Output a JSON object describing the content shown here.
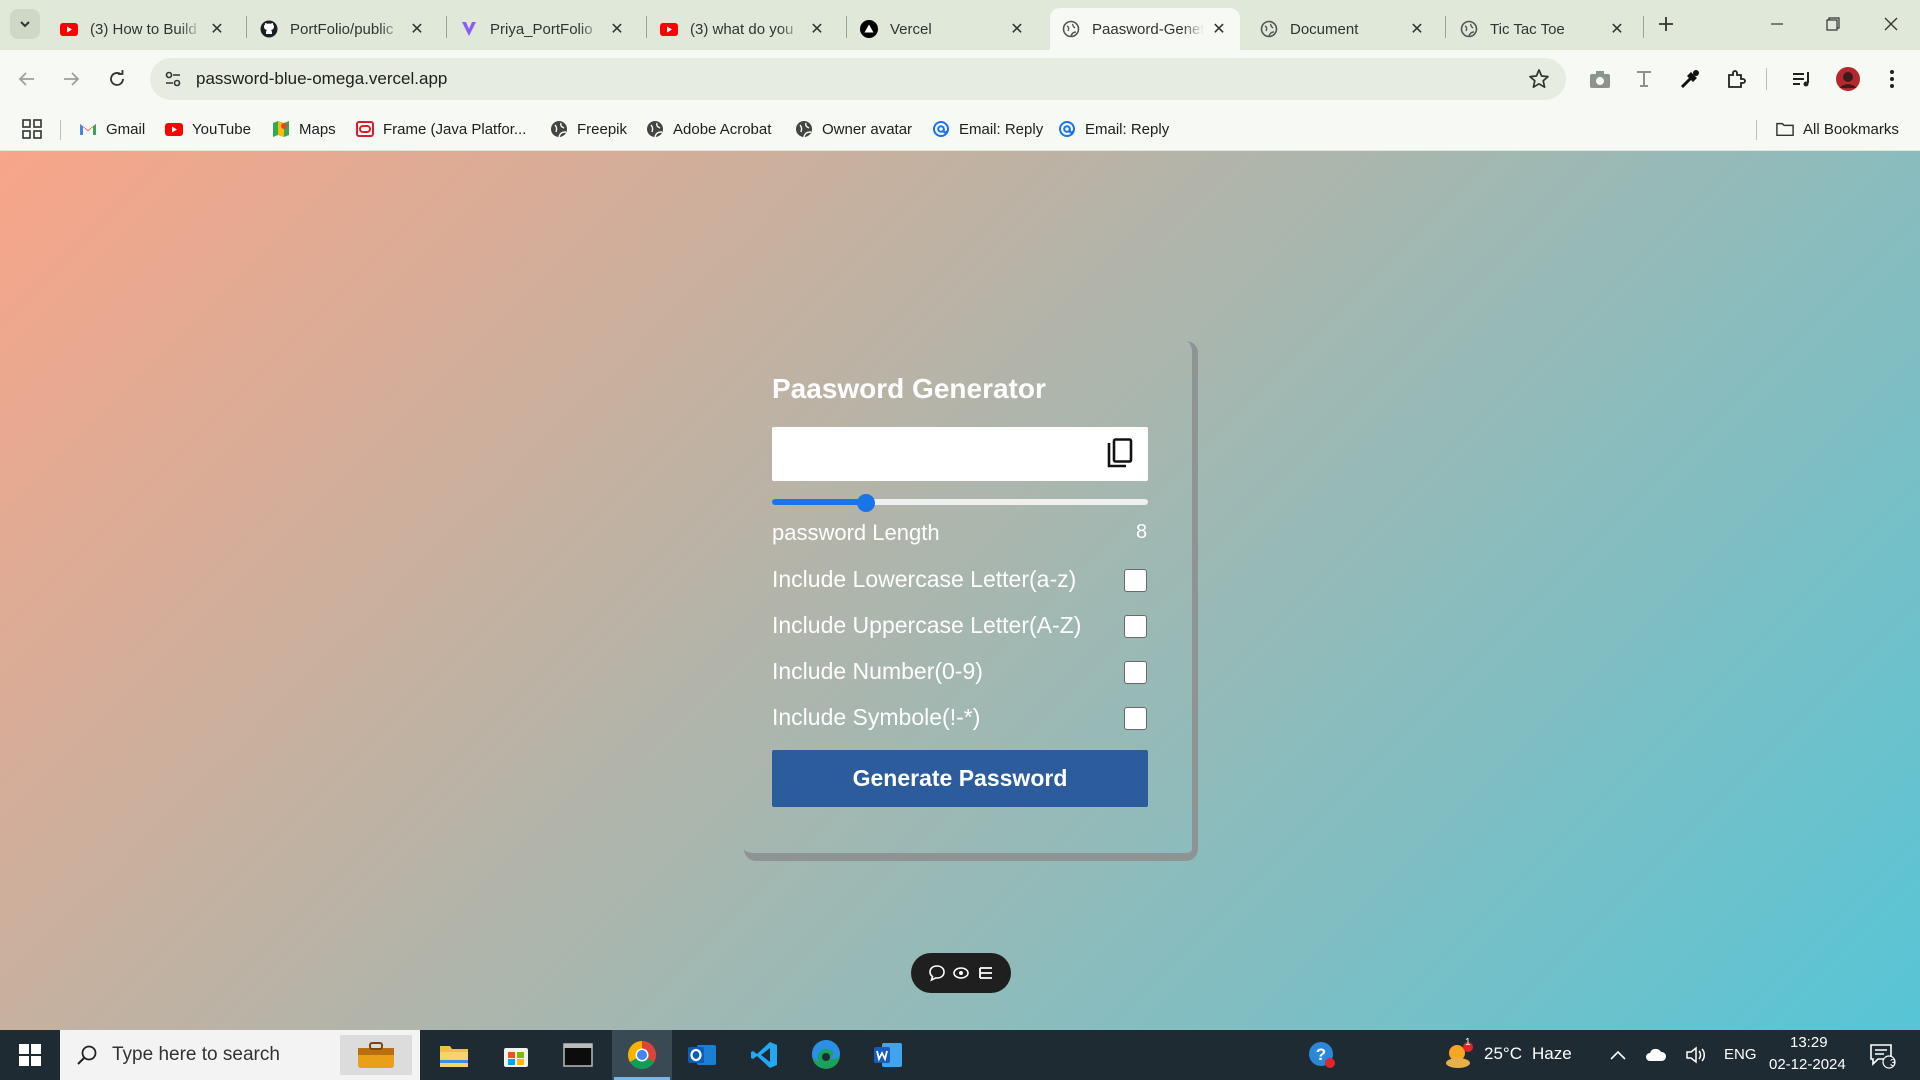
{
  "browser": {
    "tabs": [
      {
        "title": "(3) How to Build",
        "icon": "youtube-icon"
      },
      {
        "title": "PortFolio/public",
        "icon": "github-icon"
      },
      {
        "title": "Priya_PortFolio",
        "icon": "vercel-v-icon"
      },
      {
        "title": "(3) what do you",
        "icon": "youtube-icon"
      },
      {
        "title": "Vercel",
        "icon": "vercel-triangle-icon"
      },
      {
        "title": "Paasword-Genet",
        "icon": "globe-icon",
        "active": true
      },
      {
        "title": "Document",
        "icon": "globe-icon"
      },
      {
        "title": "Tic Tac Toe",
        "icon": "globe-icon"
      }
    ],
    "url": "password-blue-omega.vercel.app",
    "bookmarks": [
      {
        "label": "Gmail",
        "icon": "gmail-icon"
      },
      {
        "label": "YouTube",
        "icon": "youtube-icon"
      },
      {
        "label": "Maps",
        "icon": "maps-icon"
      },
      {
        "label": "Frame (Java Platfor...",
        "icon": "oracle-icon"
      },
      {
        "label": "Freepik",
        "icon": "globe-icon"
      },
      {
        "label": "Adobe Acrobat",
        "icon": "globe-icon"
      },
      {
        "label": "Owner avatar",
        "icon": "globe-icon"
      },
      {
        "label": "Email: Reply",
        "icon": "email-icon"
      },
      {
        "label": "Email: Reply",
        "icon": "email-icon"
      }
    ],
    "all_bookmarks": "All Bookmarks"
  },
  "app": {
    "title": "Paasword Generator",
    "password_value": "",
    "length_label": "password Length",
    "length_value": "8",
    "slider_fraction": 0.25,
    "options": [
      {
        "label": "Include Lowercase Letter(a-z)",
        "checked": false
      },
      {
        "label": "Include Uppercase Letter(A-Z)",
        "checked": false
      },
      {
        "label": "Include Number(0-9)",
        "checked": false
      },
      {
        "label": "Include Symbole(!-*)",
        "checked": false
      }
    ],
    "generate_label": "Generate Password"
  },
  "taskbar": {
    "search_placeholder": "Type here to search",
    "weather_temp": "25°C",
    "weather_desc": "Haze",
    "language": "ENG",
    "time": "13:29",
    "date": "02-12-2024",
    "notification_count": "3",
    "weather_badge": "1"
  },
  "colors": {
    "accent": "#1a73e8",
    "button": "#2c5c9c",
    "gradient_start": "#f8a589",
    "gradient_end": "#57c5d6"
  }
}
